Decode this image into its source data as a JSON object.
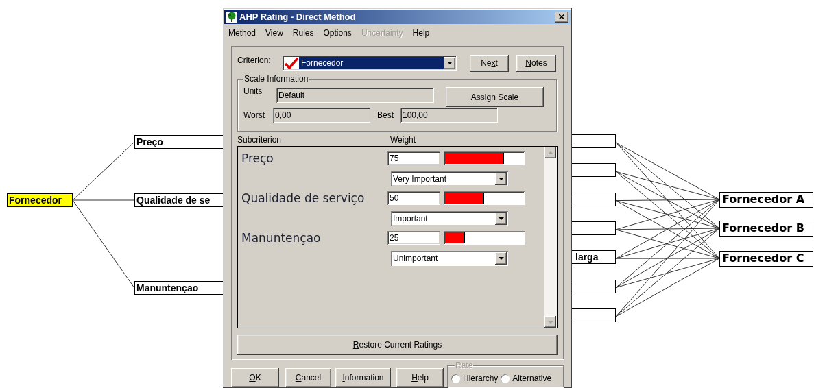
{
  "diagram": {
    "goal": {
      "label": "Fornecedor",
      "selected": true
    },
    "criteria": [
      {
        "label": "Preço"
      },
      {
        "label": "Qualidade de se"
      },
      {
        "label": "Manuntençao"
      }
    ],
    "subcriteria": [
      {
        "kind": "box"
      },
      {
        "kind": "box"
      },
      {
        "kind": "box"
      },
      {
        "kind": "box"
      },
      {
        "kind": "box",
        "label": "larga"
      },
      {
        "kind": "box"
      },
      {
        "kind": "box"
      }
    ],
    "alternatives": [
      {
        "label": "Fornecedor A"
      },
      {
        "label": "Fornecedor B"
      },
      {
        "label": "Fornecedor C"
      }
    ]
  },
  "dialog": {
    "title": "AHP Rating - Direct Method",
    "menu": [
      {
        "label": "Method",
        "disabled": false
      },
      {
        "label": "View",
        "disabled": false
      },
      {
        "label": "Rules",
        "disabled": false
      },
      {
        "label": "Options",
        "disabled": false
      },
      {
        "label": "Uncertainty",
        "disabled": true
      },
      {
        "label": "Help",
        "disabled": false
      }
    ],
    "criterion": {
      "label": "Criterion:",
      "value": "Fornecedor"
    },
    "top_buttons": [
      {
        "label": {
          "pre": "Ne",
          "key": "x",
          "post": "t"
        }
      },
      {
        "label": {
          "key": "N",
          "post": "otes"
        }
      }
    ],
    "scale": {
      "legend": "Scale Information",
      "units_label": "Units",
      "units": "Default",
      "assign_button": {
        "label": {
          "pre": "Assign ",
          "key": "S",
          "post": "cale"
        }
      },
      "worst_label": "Worst",
      "worst": "0,00",
      "best_label": "Best",
      "best": "100,00"
    },
    "columns": [
      "Subcriterion",
      "Weight"
    ],
    "rows": [
      {
        "name": "Preço",
        "weight": "75",
        "level": 0.75,
        "rating": "Very Important"
      },
      {
        "name": "Qualidade de serviço",
        "weight": "50",
        "level": 0.5,
        "rating": "Important"
      },
      {
        "name": "Manuntençao",
        "weight": "25",
        "level": 0.25,
        "rating": "Unimportant"
      }
    ],
    "restore_button": {
      "label": {
        "key": "R",
        "post": "estore Current Ratings"
      }
    },
    "buttons": [
      {
        "label": {
          "key": "O",
          "post": "K"
        }
      },
      {
        "label": {
          "key": "C",
          "post": "ancel"
        }
      },
      {
        "label": {
          "key": "I",
          "post": "nformation"
        }
      },
      {
        "label": {
          "key": "H",
          "post": "elp"
        }
      }
    ],
    "rate": {
      "legend": "Rate",
      "disabled": true,
      "options": [
        {
          "label": "Hierarchy",
          "selected": false
        },
        {
          "label": "Alternative",
          "selected": false
        }
      ]
    }
  }
}
